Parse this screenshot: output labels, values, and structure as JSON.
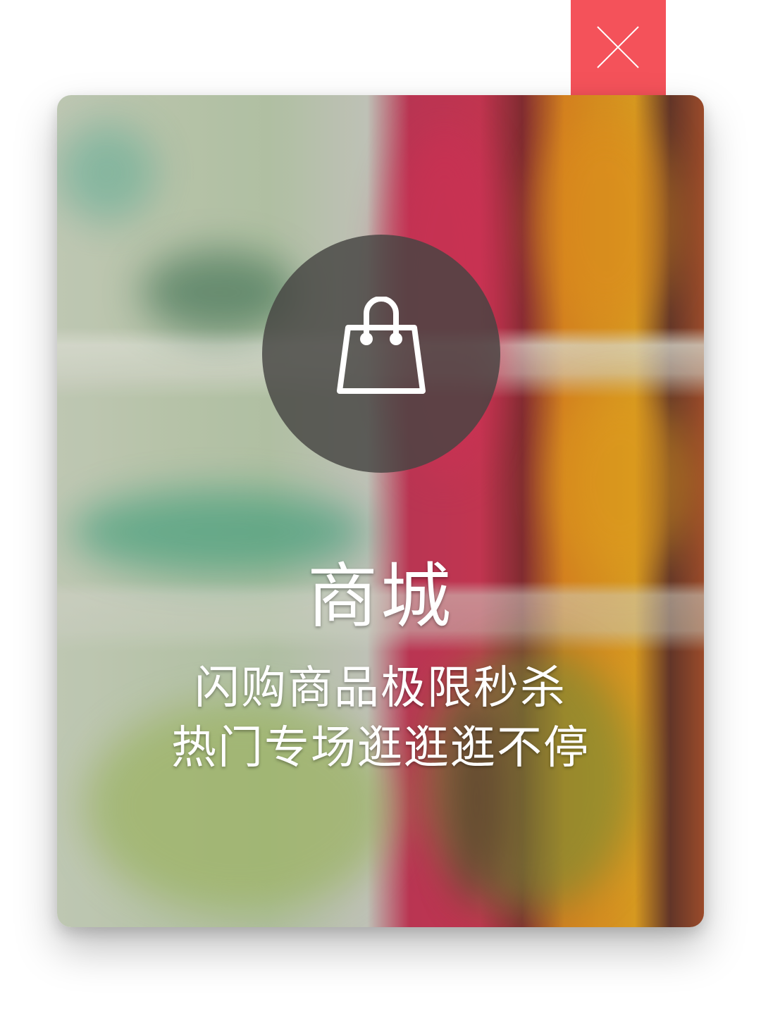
{
  "promo": {
    "title": "商城",
    "line1": "闪购商品极限秒杀",
    "line2": "热门专场逛逛逛不停"
  },
  "icons": {
    "close": "close-icon",
    "center": "shopping-bag-icon"
  },
  "colors": {
    "close_tab": "#f4525a",
    "circle_bg": "#464442",
    "text": "#ffffff"
  }
}
